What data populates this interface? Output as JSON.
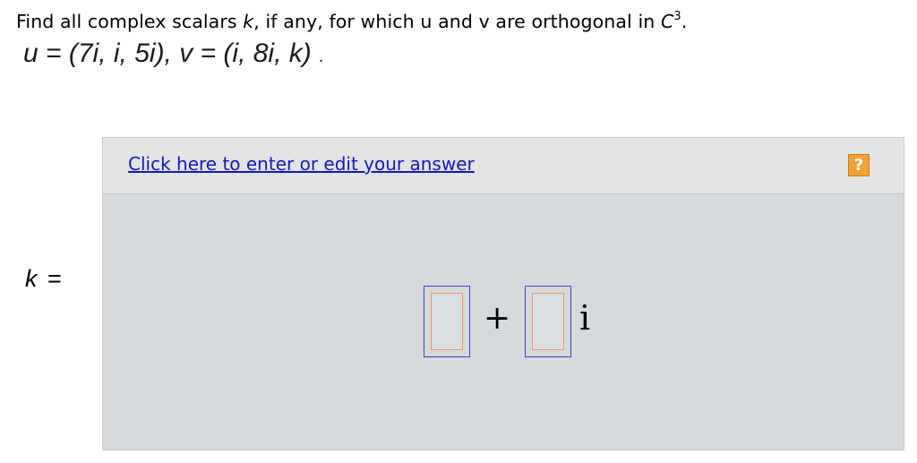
{
  "question": {
    "text": "Find all complex scalars k, if any, for which u and v are orthogonal in C",
    "var_k": "k",
    "space_superscript": "3",
    "end_punct": "."
  },
  "vectors": {
    "text": "u = (7i, i, 5i), v = (i, 8i, k)",
    "trailing_dot": "."
  },
  "answer_label": {
    "var": "k",
    "equals": "="
  },
  "panel": {
    "edit_link": "Click here to enter or edit your answer",
    "help_symbol": "?"
  },
  "answer_template": {
    "real_part_value": "",
    "operator": "+",
    "imag_part_value": "",
    "imag_unit": "i"
  },
  "colors": {
    "link": "#1515cc",
    "panel_bg": "#d7dadd",
    "header_bg": "#e4e4e4",
    "help_icon": "#f0a436",
    "input_outer": "#3d3dcc",
    "input_inner": "#f2955e"
  }
}
